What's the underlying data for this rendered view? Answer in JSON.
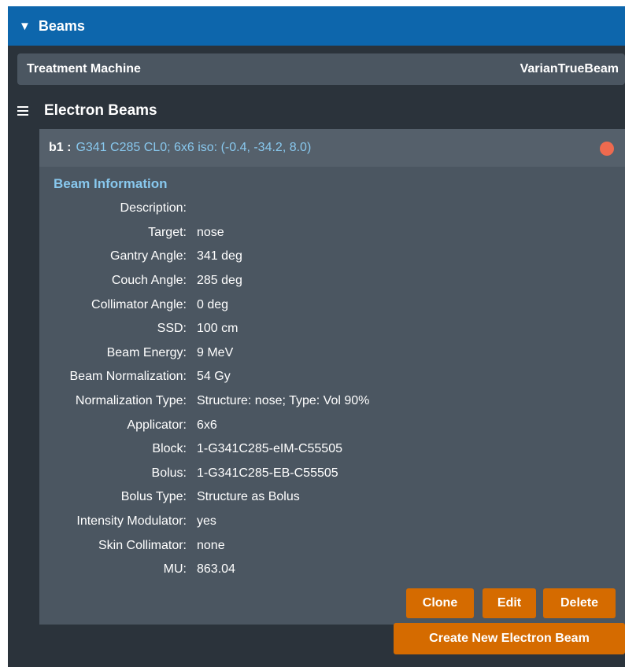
{
  "header": {
    "toggle_icon": "triangle-down-icon",
    "title": "Beams"
  },
  "machine": {
    "label": "Treatment Machine",
    "value": "VarianTrueBeam"
  },
  "section": {
    "icon": "hamburger-icon",
    "title": "Electron Beams"
  },
  "beam": {
    "id": "b1 :",
    "summary": "G341 C285 CL0; 6x6 iso: (-0.4, -34.2, 8.0)",
    "status_color": "#ee6a4f",
    "info_title": "Beam Information",
    "fields": [
      {
        "label": "Description:",
        "value": ""
      },
      {
        "label": "Target:",
        "value": "nose"
      },
      {
        "label": "Gantry Angle:",
        "value": "341 deg"
      },
      {
        "label": "Couch Angle:",
        "value": "285 deg"
      },
      {
        "label": "Collimator Angle:",
        "value": "0 deg"
      },
      {
        "label": "SSD:",
        "value": "100 cm"
      },
      {
        "label": "Beam Energy:",
        "value": "9 MeV"
      },
      {
        "label": "Beam Normalization:",
        "value": "54 Gy"
      },
      {
        "label": "Normalization Type:",
        "value": "Structure: nose;  Type: Vol 90%"
      },
      {
        "label": "Applicator:",
        "value": "6x6"
      },
      {
        "label": "Block:",
        "value": "1-G341C285-eIM-C55505"
      },
      {
        "label": "Bolus:",
        "value": "1-G341C285-EB-C55505"
      },
      {
        "label": "Bolus Type:",
        "value": "Structure as Bolus"
      },
      {
        "label": "Intensity Modulator:",
        "value": "yes"
      },
      {
        "label": "Skin Collimator:",
        "value": "none"
      },
      {
        "label": "MU:",
        "value": "863.04"
      }
    ]
  },
  "buttons": {
    "clone": "Clone",
    "edit": "Edit",
    "delete": "Delete",
    "create": "Create New Electron Beam"
  },
  "colors": {
    "header": "#0d66ac",
    "accent": "#d56b00",
    "link": "#88c8ee"
  }
}
